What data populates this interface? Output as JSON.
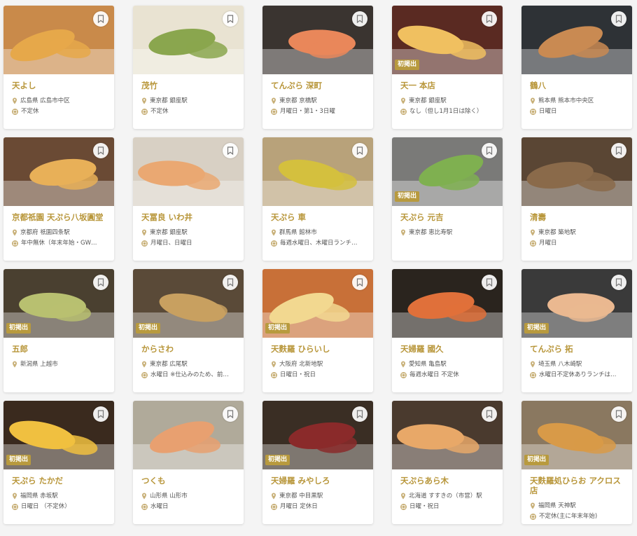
{
  "accent": "#b8963a",
  "restaurants": [
    {
      "name": "天よし",
      "location": "広島県 広島市中区",
      "closed": "不定休",
      "new": false,
      "bg": "#c98a4a",
      "food": "#e6a84a"
    },
    {
      "name": "茂竹",
      "location": "東京都 銀座駅",
      "closed": "不定休",
      "new": false,
      "bg": "#e9e3d2",
      "food": "#8aa64e"
    },
    {
      "name": "てんぷら 深町",
      "location": "東京都 京橋駅",
      "closed": "月曜日・第1・3日曜",
      "new": false,
      "bg": "#3a3430",
      "food": "#e9875a"
    },
    {
      "name": "天一 本店",
      "location": "東京都 銀座駅",
      "closed": "なし（但し1月1日は除く）",
      "new": true,
      "bg": "#5a2a22",
      "food": "#f0c060"
    },
    {
      "name": "鶴八",
      "location": "熊本県 熊本市中央区",
      "closed": "日曜日",
      "new": false,
      "bg": "#2e3236",
      "food": "#c98a52"
    },
    {
      "name": "京都祇園 天ぷら八坂圓堂",
      "location": "京都府 祇園四条駅",
      "closed": "年中無休（年末年始・GW…",
      "new": false,
      "bg": "#6a4a34",
      "food": "#e8b058"
    },
    {
      "name": "天冨良 いわ井",
      "location": "東京都 銀座駅",
      "closed": "月曜日、日曜日",
      "new": false,
      "bg": "#d8d0c4",
      "food": "#eaa872"
    },
    {
      "name": "天ぷら 車",
      "location": "群馬県 館林市",
      "closed": "毎週水曜日、木曜日ランチ…",
      "new": false,
      "bg": "#b8a27a",
      "food": "#d4c03e"
    },
    {
      "name": "天ぷら 元吉",
      "location": "東京都 恵比寿駅",
      "closed": "",
      "new": true,
      "bg": "#7a7a78",
      "food": "#7fb050"
    },
    {
      "name": "清壽",
      "location": "東京都 築地駅",
      "closed": "月曜日",
      "new": false,
      "bg": "#5a4634",
      "food": "#8a6a4a"
    },
    {
      "name": "五郎",
      "location": "新潟県 上越市",
      "closed": "",
      "new": true,
      "bg": "#4a4030",
      "food": "#b8c070"
    },
    {
      "name": "からさわ",
      "location": "東京都 広尾駅",
      "closed": "水曜日 ※仕込みのため、前…",
      "new": true,
      "bg": "#5a4a38",
      "food": "#c8a060"
    },
    {
      "name": "天麩羅 ひらいし",
      "location": "大阪府 北新地駅",
      "closed": "日曜日・祝日",
      "new": true,
      "bg": "#c87038",
      "food": "#f2d890"
    },
    {
      "name": "天婦羅 國久",
      "location": "愛知県 亀島駅",
      "closed": "毎週水曜日 不定休",
      "new": false,
      "bg": "#2a241e",
      "food": "#e0703a"
    },
    {
      "name": "てんぷら 拓",
      "location": "埼玉県 八木崎駅",
      "closed": "水曜日不定休ありランチは…",
      "new": true,
      "bg": "#3a3a3a",
      "food": "#eab890"
    },
    {
      "name": "天ぷら たかだ",
      "location": "福岡県 赤坂駅",
      "closed": "日曜日 （不定休）",
      "new": true,
      "bg": "#3a2a1e",
      "food": "#f0c040"
    },
    {
      "name": "つくも",
      "location": "山形県 山形市",
      "closed": "水曜日",
      "new": false,
      "bg": "#b0aa9a",
      "food": "#e8a070"
    },
    {
      "name": "天婦羅 みやしろ",
      "location": "東京都 中目黒駅",
      "closed": "月曜日 定休日",
      "new": true,
      "bg": "#3a2e24",
      "food": "#8a2a2a"
    },
    {
      "name": "天ぷらあら木",
      "location": "北海道 すすきの（市営）駅",
      "closed": "日曜・祝日",
      "new": false,
      "bg": "#4a3a2e",
      "food": "#e8a868"
    },
    {
      "name": "天麩羅処ひらお アクロス店",
      "location": "福岡県 天神駅",
      "closed": "不定休(主に年末年始)",
      "new": true,
      "bg": "#8a7860",
      "food": "#d89a48"
    }
  ],
  "badge_label": "初掲出"
}
